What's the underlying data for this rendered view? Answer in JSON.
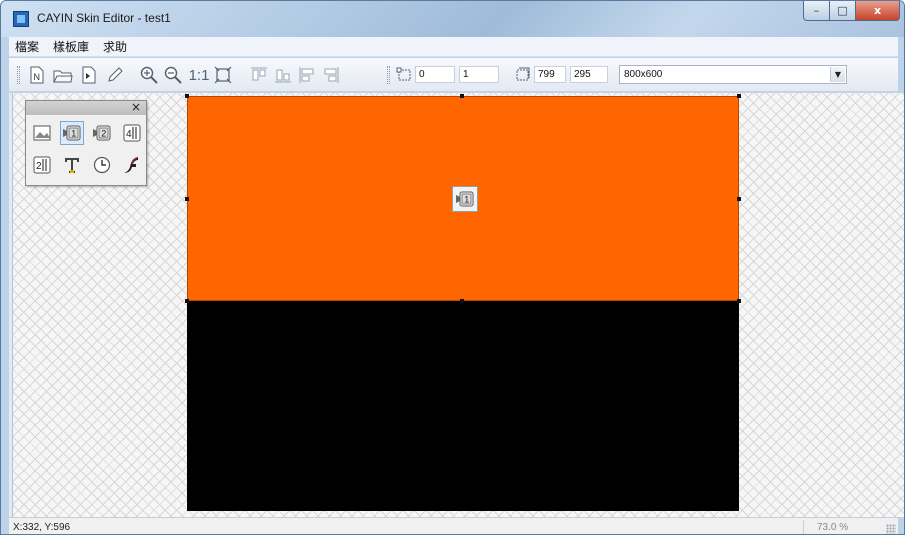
{
  "window": {
    "title": "CAYIN Skin Editor - test1",
    "controls": {
      "minimize": "–",
      "maximize": "□",
      "close": "x"
    }
  },
  "menubar": {
    "items": [
      "檔案",
      "樣板庫",
      "求助"
    ]
  },
  "toolbar": {
    "file_icons": [
      "new-file-icon",
      "open-folder-icon",
      "import-icon",
      "edit-pencil-icon"
    ],
    "zoom_icons": [
      "zoom-in-icon",
      "zoom-out-icon",
      "actual-size-icon",
      "fit-to-window-icon"
    ],
    "actual_size_label": "1:1",
    "align_icons": [
      "align-top-icon",
      "align-bottom-icon",
      "align-left-icon",
      "align-right-icon"
    ],
    "position": {
      "x": "0",
      "y": "1"
    },
    "size": {
      "w": "799",
      "h": "295"
    },
    "resolution": "800x600"
  },
  "palette": {
    "close": "×",
    "tools": [
      "image-zone-icon",
      "video-zone-1-icon",
      "video-zone-2-icon",
      "media-zone-4-icon",
      "media-zone-2-icon",
      "text-zone-icon",
      "clock-zone-icon",
      "flash-zone-icon"
    ],
    "active_tool": 1
  },
  "canvas": {
    "zones": [
      {
        "name": "video-zone-1",
        "color": "#ff6600",
        "selected": true,
        "icon": "video-zone-1-icon"
      },
      {
        "name": "background-zone",
        "color": "#000000",
        "selected": false
      }
    ]
  },
  "statusbar": {
    "coordinates": "X:332, Y:596",
    "zoom": "73.0 %"
  },
  "colors": {
    "accent": "#ff6600",
    "background_zone": "#000000",
    "titlebar": "#b6cde6"
  }
}
